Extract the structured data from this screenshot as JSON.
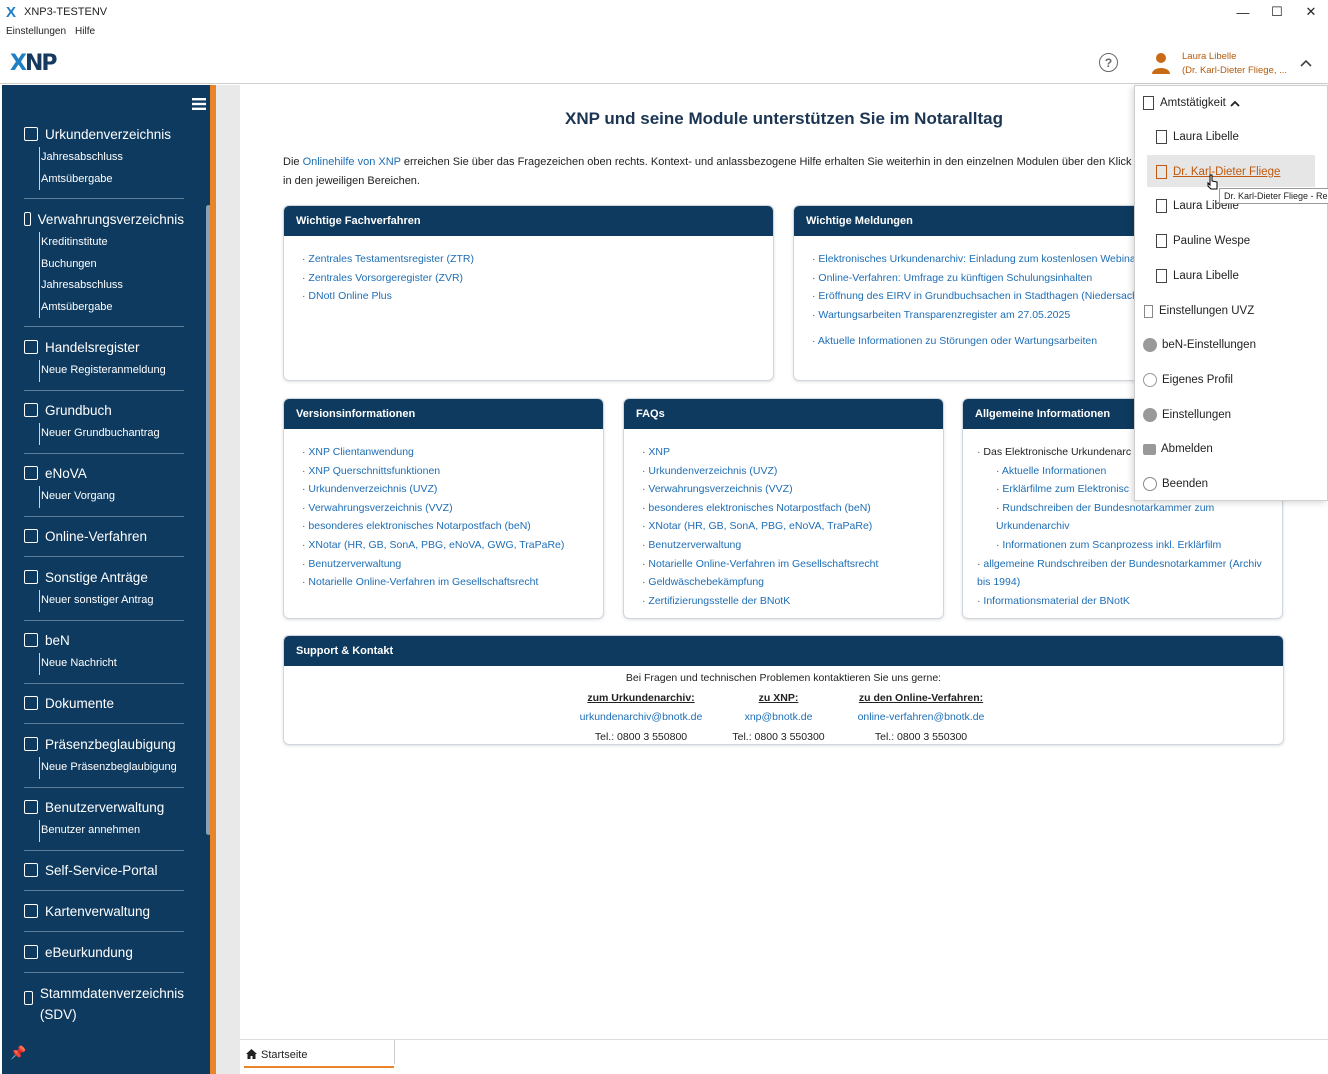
{
  "window": {
    "title": "XNP3-TESTENV",
    "min": "—",
    "max": "☐",
    "close": "✕"
  },
  "menu": [
    "Einstellungen",
    "Hilfe"
  ],
  "header": {
    "logo": "XNP",
    "user_line1": "Laura Libelle",
    "user_line2": "(Dr. Karl-Dieter Fliege, ...",
    "help": "?"
  },
  "sidebar": {
    "sections": [
      {
        "label": "Urkundenverzeichnis",
        "subs": [
          "Jahresabschluss",
          "Amtsübergabe"
        ]
      },
      {
        "label": "Verwahrungsverzeichnis",
        "subs": [
          "Kreditinstitute",
          "Buchungen",
          "Jahresabschluss",
          "Amtsübergabe"
        ]
      },
      {
        "label": "Handelsregister",
        "subs": [
          "Neue Registeranmeldung"
        ]
      },
      {
        "label": "Grundbuch",
        "subs": [
          "Neuer Grundbuchantrag"
        ]
      },
      {
        "label": "eNoVA",
        "subs": [
          "Neuer Vorgang"
        ]
      },
      {
        "label": "Online-Verfahren",
        "subs": []
      },
      {
        "label": "Sonstige Anträge",
        "subs": [
          "Neuer sonstiger Antrag"
        ]
      },
      {
        "label": "beN",
        "subs": [
          "Neue Nachricht"
        ]
      },
      {
        "label": "Dokumente",
        "subs": []
      },
      {
        "label": "Präsenzbeglaubigung",
        "subs": [
          "Neue Präsenzbeglaubigung"
        ]
      },
      {
        "label": "Benutzerverwaltung",
        "subs": [
          "Benutzer annehmen"
        ]
      },
      {
        "label": "Self-Service-Portal",
        "subs": []
      },
      {
        "label": "Kartenverwaltung",
        "subs": []
      },
      {
        "label": "eBeurkundung",
        "subs": []
      },
      {
        "label": "Stammdatenverzeichnis (SDV)",
        "subs": []
      }
    ]
  },
  "main": {
    "headline": "XNP und seine Module unterstützen Sie im Notaralltag",
    "intro_pre": "Die ",
    "intro_link": "Onlinehilfe von XNP",
    "intro_post": " erreichen Sie über das Fragezeichen oben rechts. Kontext- und anlassbezogene Hilfe erhalten Sie weiterhin in den einzelnen Modulen über den Klick der d",
    "intro_line2": "in den jeweiligen Bereichen.",
    "cards": {
      "fachverfahren": {
        "title": "Wichtige Fachverfahren",
        "items": [
          "Zentrales Testamentsregister (ZTR)",
          "Zentrales Vorsorgeregister (ZVR)",
          "DNotI Online Plus"
        ]
      },
      "meldungen": {
        "title": "Wichtige Meldungen",
        "items": [
          "Elektronisches Urkundenarchiv: Einladung zum kostenlosen Webina",
          "Online-Verfahren: Umfrage zu künftigen Schulungsinhalten",
          "Eröffnung des EIRV in Grundbuchsachen in Stadthagen (Niedersach",
          "Wartungsarbeiten Transparenzregister am 27.05.2025",
          "Aktuelle Informationen zu Störungen oder Wartungsarbeiten"
        ]
      },
      "versionen": {
        "title": "Versionsinformationen",
        "items": [
          "XNP Clientanwendung",
          "XNP Querschnittsfunktionen",
          "Urkundenverzeichnis (UVZ)",
          "Verwahrungsverzeichnis (VVZ)",
          "besonderes elektronisches Notarpostfach (beN)",
          "XNotar (HR, GB, SonA, PBG, eNoVA, GWG, TraPaRe)",
          "Benutzerverwaltung",
          "Notarielle Online-Verfahren im Gesellschaftsrecht"
        ]
      },
      "faqs": {
        "title": "FAQs",
        "items": [
          "XNP",
          "Urkundenverzeichnis (UVZ)",
          "Verwahrungsverzeichnis (VVZ)",
          "besonderes elektronisches Notarpostfach (beN)",
          "XNotar (HR, GB, SonA, PBG, eNoVA, TraPaRe)",
          "Benutzerverwaltung",
          "Notarielle Online-Verfahren im Gesellschaftsrecht",
          "Geldwäschebekämpfung",
          "Zertifizierungsstelle der BNotK"
        ]
      },
      "allgemein": {
        "title": "Allgemeine Informationen",
        "item0": "Das Elektronische Urkundenarc",
        "sub1": "Aktuelle Informationen",
        "sub2": "Erklärfilme zum Elektronisc",
        "sub3a": "Rundschreiben der Bundesnotarkammer zum",
        "sub3b": "Urkundenarchiv",
        "sub4": "Informationen zum Scanprozess inkl. Erklärfilm",
        "item5a": "allgemeine Rundschreiben der Bundesnotarkammer (Archiv",
        "item5b": "bis 1994)",
        "item6": "Informationsmaterial der BNotK"
      },
      "support": {
        "title": "Support & Kontakt",
        "intro": "Bei Fragen und technischen Problemen kontaktieren Sie uns gerne:",
        "cols": [
          {
            "head": "zum Urkundenarchiv:",
            "mail": "urkundenarchiv@bnotk.de",
            "tel": "Tel.: 0800 3 550800"
          },
          {
            "head": "zu XNP:",
            "mail": "xnp@bnotk.de",
            "tel": "Tel.: 0800 3 550300"
          },
          {
            "head": "zu den Online-Verfahren:",
            "mail": "online-verfahren@bnotk.de",
            "tel": "Tel.: 0800 3 550300"
          }
        ]
      }
    }
  },
  "tabbar": {
    "tab": "Startseite"
  },
  "dropdown": {
    "header": "Amtstätigkeit",
    "items": [
      "Laura Libelle",
      "Dr. Karl-Dieter Fliege",
      "Laura Libelle",
      "Pauline Wespe",
      "Laura Libelle",
      "Einstellungen UVZ",
      "beN-Einstellungen",
      "Eigenes Profil",
      "Einstellungen",
      "Abmelden",
      "Beenden"
    ],
    "tooltip": "Dr. Karl-Dieter Fliege - Re"
  },
  "colors": {
    "navy": "#0e3a5f",
    "orange": "#e8842a",
    "link": "#1e6eb5"
  }
}
